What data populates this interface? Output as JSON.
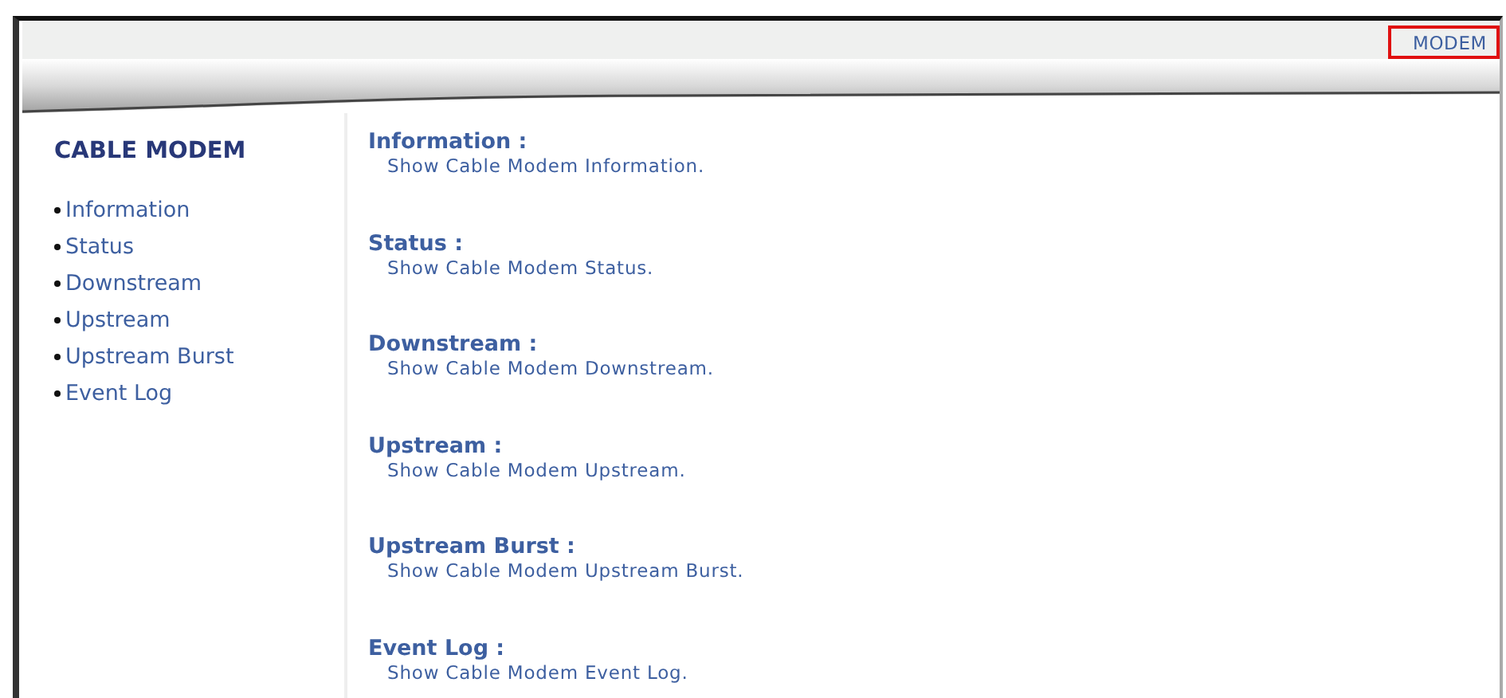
{
  "top_bar": {
    "link": {
      "label": "MODEM",
      "highlighted": true
    }
  },
  "sidebar": {
    "title": "CABLE MODEM",
    "items": [
      {
        "label": "Information"
      },
      {
        "label": "Status"
      },
      {
        "label": "Downstream"
      },
      {
        "label": "Upstream"
      },
      {
        "label": "Upstream Burst"
      },
      {
        "label": "Event Log"
      }
    ]
  },
  "sections": [
    {
      "title": "Information :",
      "description": "Show Cable Modem Information."
    },
    {
      "title": "Status :",
      "description": "Show Cable Modem Status."
    },
    {
      "title": "Downstream :",
      "description": "Show Cable Modem Downstream."
    },
    {
      "title": "Upstream :",
      "description": "Show Cable Modem Upstream."
    },
    {
      "title": "Upstream Burst :",
      "description": "Show Cable Modem Upstream Burst."
    },
    {
      "title": "Event Log :",
      "description": "Show Cable Modem Event Log."
    }
  ]
}
